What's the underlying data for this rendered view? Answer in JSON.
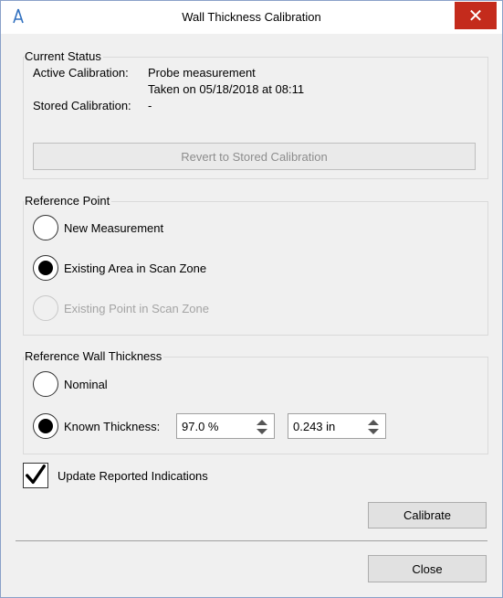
{
  "window": {
    "title": "Wall Thickness Calibration",
    "close_glyph": "✕"
  },
  "current_status": {
    "legend": "Current Status",
    "active_label": "Active Calibration:",
    "active_value": "Probe measurement",
    "active_taken": "Taken on 05/18/2018 at 08:11",
    "stored_label": "Stored Calibration:",
    "stored_value": "-",
    "revert_button": "Revert to Stored Calibration"
  },
  "reference_point": {
    "legend": "Reference Point",
    "options": [
      {
        "label": "New Measurement",
        "selected": false,
        "enabled": true
      },
      {
        "label": "Existing Area in Scan Zone",
        "selected": true,
        "enabled": true
      },
      {
        "label": "Existing Point in Scan Zone",
        "selected": false,
        "enabled": false
      }
    ]
  },
  "reference_wall_thickness": {
    "legend": "Reference Wall Thickness",
    "nominal_label": "Nominal",
    "nominal_selected": false,
    "known_label": "Known Thickness:",
    "known_selected": true,
    "percent_value": "97.0 %",
    "inch_value": "0.243 in"
  },
  "update_reported": {
    "label": "Update Reported Indications",
    "checked": true
  },
  "buttons": {
    "calibrate": "Calibrate",
    "close": "Close"
  },
  "colors": {
    "close_button_bg": "#c42b1c",
    "app_icon": "#2f6fbf"
  },
  "icons": {
    "app": "app-logo-icon",
    "close": "close-icon",
    "spinner": "spin-arrows-icon",
    "checkmark": "checkmark-icon"
  }
}
